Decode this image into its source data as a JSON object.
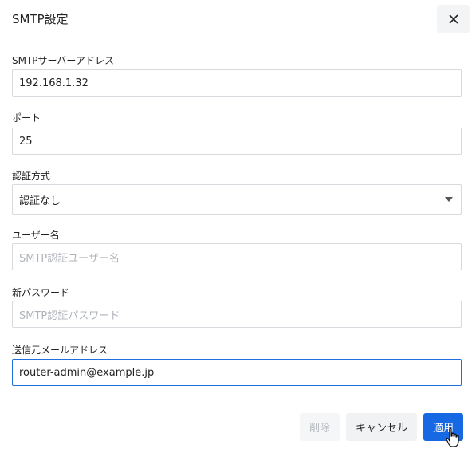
{
  "dialog": {
    "title": "SMTP設定"
  },
  "fields": {
    "smtp_server": {
      "label": "SMTPサーバーアドレス",
      "value": "192.168.1.32"
    },
    "port": {
      "label": "ポート",
      "value": "25"
    },
    "auth_method": {
      "label": "認証方式",
      "selected": "認証なし"
    },
    "username": {
      "label": "ユーザー名",
      "placeholder": "SMTP認証ユーザー名"
    },
    "new_password": {
      "label": "新パスワード",
      "placeholder": "SMTP認証パスワード"
    },
    "sender_email": {
      "label": "送信元メールアドレス",
      "value": "router-admin@example.jp"
    }
  },
  "footer": {
    "delete_label": "削除",
    "cancel_label": "キャンセル",
    "apply_label": "適用"
  },
  "colors": {
    "accent": "#1668e3",
    "focus_border": "#1f6fe0",
    "placeholder_text": "#b0b4ba"
  }
}
